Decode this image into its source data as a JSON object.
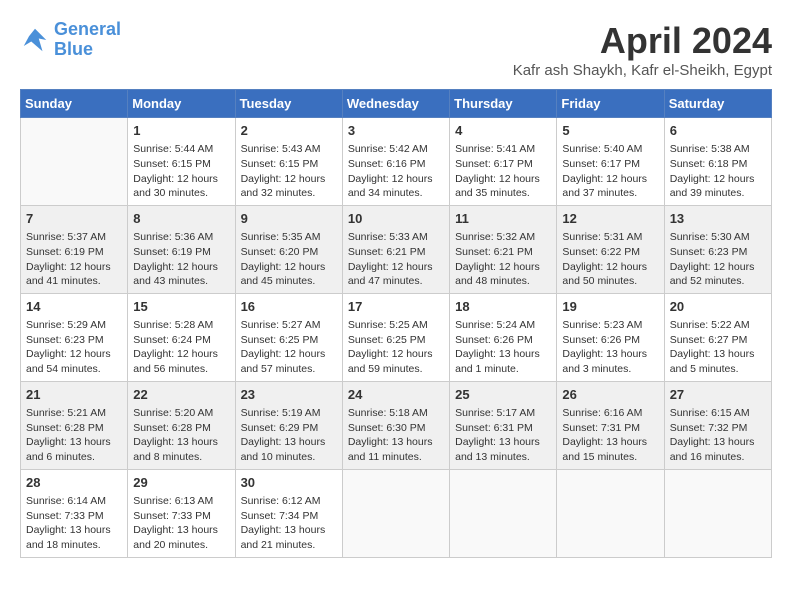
{
  "header": {
    "logo_line1": "General",
    "logo_line2": "Blue",
    "month": "April 2024",
    "location": "Kafr ash Shaykh, Kafr el-Sheikh, Egypt"
  },
  "weekdays": [
    "Sunday",
    "Monday",
    "Tuesday",
    "Wednesday",
    "Thursday",
    "Friday",
    "Saturday"
  ],
  "weeks": [
    [
      {
        "day": "",
        "info": ""
      },
      {
        "day": "1",
        "info": "Sunrise: 5:44 AM\nSunset: 6:15 PM\nDaylight: 12 hours\nand 30 minutes."
      },
      {
        "day": "2",
        "info": "Sunrise: 5:43 AM\nSunset: 6:15 PM\nDaylight: 12 hours\nand 32 minutes."
      },
      {
        "day": "3",
        "info": "Sunrise: 5:42 AM\nSunset: 6:16 PM\nDaylight: 12 hours\nand 34 minutes."
      },
      {
        "day": "4",
        "info": "Sunrise: 5:41 AM\nSunset: 6:17 PM\nDaylight: 12 hours\nand 35 minutes."
      },
      {
        "day": "5",
        "info": "Sunrise: 5:40 AM\nSunset: 6:17 PM\nDaylight: 12 hours\nand 37 minutes."
      },
      {
        "day": "6",
        "info": "Sunrise: 5:38 AM\nSunset: 6:18 PM\nDaylight: 12 hours\nand 39 minutes."
      }
    ],
    [
      {
        "day": "7",
        "info": "Sunrise: 5:37 AM\nSunset: 6:19 PM\nDaylight: 12 hours\nand 41 minutes."
      },
      {
        "day": "8",
        "info": "Sunrise: 5:36 AM\nSunset: 6:19 PM\nDaylight: 12 hours\nand 43 minutes."
      },
      {
        "day": "9",
        "info": "Sunrise: 5:35 AM\nSunset: 6:20 PM\nDaylight: 12 hours\nand 45 minutes."
      },
      {
        "day": "10",
        "info": "Sunrise: 5:33 AM\nSunset: 6:21 PM\nDaylight: 12 hours\nand 47 minutes."
      },
      {
        "day": "11",
        "info": "Sunrise: 5:32 AM\nSunset: 6:21 PM\nDaylight: 12 hours\nand 48 minutes."
      },
      {
        "day": "12",
        "info": "Sunrise: 5:31 AM\nSunset: 6:22 PM\nDaylight: 12 hours\nand 50 minutes."
      },
      {
        "day": "13",
        "info": "Sunrise: 5:30 AM\nSunset: 6:23 PM\nDaylight: 12 hours\nand 52 minutes."
      }
    ],
    [
      {
        "day": "14",
        "info": "Sunrise: 5:29 AM\nSunset: 6:23 PM\nDaylight: 12 hours\nand 54 minutes."
      },
      {
        "day": "15",
        "info": "Sunrise: 5:28 AM\nSunset: 6:24 PM\nDaylight: 12 hours\nand 56 minutes."
      },
      {
        "day": "16",
        "info": "Sunrise: 5:27 AM\nSunset: 6:25 PM\nDaylight: 12 hours\nand 57 minutes."
      },
      {
        "day": "17",
        "info": "Sunrise: 5:25 AM\nSunset: 6:25 PM\nDaylight: 12 hours\nand 59 minutes."
      },
      {
        "day": "18",
        "info": "Sunrise: 5:24 AM\nSunset: 6:26 PM\nDaylight: 13 hours\nand 1 minute."
      },
      {
        "day": "19",
        "info": "Sunrise: 5:23 AM\nSunset: 6:26 PM\nDaylight: 13 hours\nand 3 minutes."
      },
      {
        "day": "20",
        "info": "Sunrise: 5:22 AM\nSunset: 6:27 PM\nDaylight: 13 hours\nand 5 minutes."
      }
    ],
    [
      {
        "day": "21",
        "info": "Sunrise: 5:21 AM\nSunset: 6:28 PM\nDaylight: 13 hours\nand 6 minutes."
      },
      {
        "day": "22",
        "info": "Sunrise: 5:20 AM\nSunset: 6:28 PM\nDaylight: 13 hours\nand 8 minutes."
      },
      {
        "day": "23",
        "info": "Sunrise: 5:19 AM\nSunset: 6:29 PM\nDaylight: 13 hours\nand 10 minutes."
      },
      {
        "day": "24",
        "info": "Sunrise: 5:18 AM\nSunset: 6:30 PM\nDaylight: 13 hours\nand 11 minutes."
      },
      {
        "day": "25",
        "info": "Sunrise: 5:17 AM\nSunset: 6:31 PM\nDaylight: 13 hours\nand 13 minutes."
      },
      {
        "day": "26",
        "info": "Sunrise: 6:16 AM\nSunset: 7:31 PM\nDaylight: 13 hours\nand 15 minutes."
      },
      {
        "day": "27",
        "info": "Sunrise: 6:15 AM\nSunset: 7:32 PM\nDaylight: 13 hours\nand 16 minutes."
      }
    ],
    [
      {
        "day": "28",
        "info": "Sunrise: 6:14 AM\nSunset: 7:33 PM\nDaylight: 13 hours\nand 18 minutes."
      },
      {
        "day": "29",
        "info": "Sunrise: 6:13 AM\nSunset: 7:33 PM\nDaylight: 13 hours\nand 20 minutes."
      },
      {
        "day": "30",
        "info": "Sunrise: 6:12 AM\nSunset: 7:34 PM\nDaylight: 13 hours\nand 21 minutes."
      },
      {
        "day": "",
        "info": ""
      },
      {
        "day": "",
        "info": ""
      },
      {
        "day": "",
        "info": ""
      },
      {
        "day": "",
        "info": ""
      }
    ]
  ]
}
